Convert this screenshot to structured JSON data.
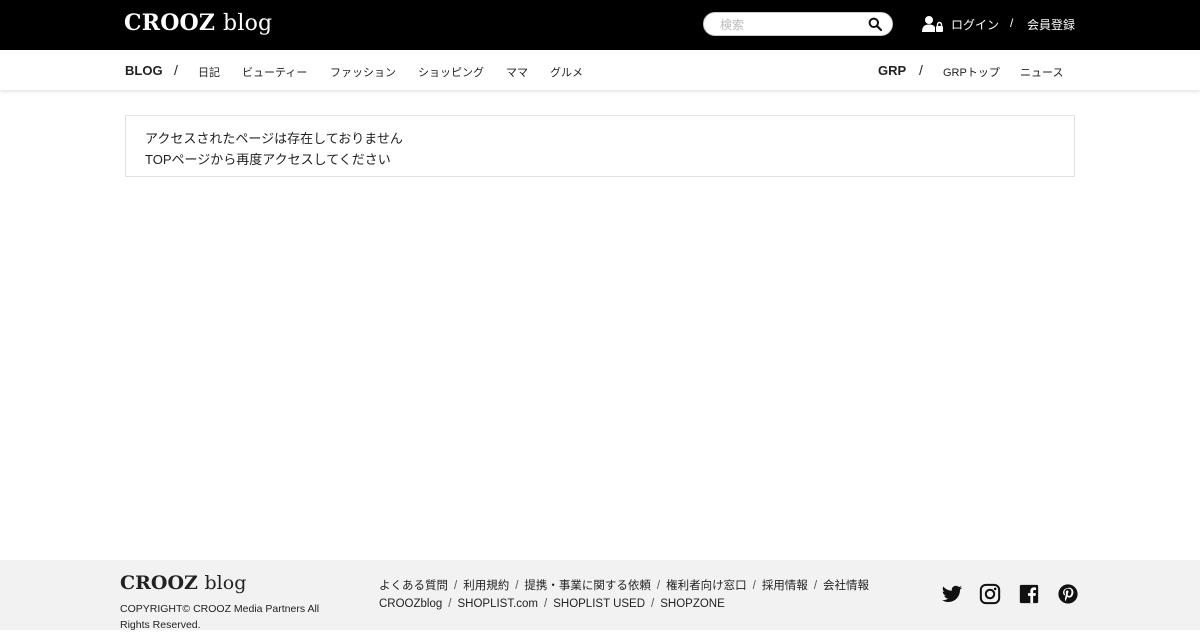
{
  "header": {
    "logo_main": "CROOZ",
    "logo_sub": "blog",
    "search_placeholder": "検索",
    "login_label": "ログイン",
    "separator": "/",
    "register_label": "会員登録"
  },
  "subnav": {
    "blog_label": "BLOG",
    "slash": "/",
    "blog_items": [
      "日記",
      "ビューティー",
      "ファッション",
      "ショッピング",
      "ママ",
      "グルメ"
    ],
    "grp_label": "GRP",
    "grp_items": [
      "GRPトップ",
      "ニュース"
    ]
  },
  "message": {
    "line1": "アクセスされたページは存在しておりません",
    "line2": "TOPページから再度アクセスしてください"
  },
  "footer": {
    "logo_main": "CROOZ",
    "logo_sub": "blog",
    "copyright": "COPYRIGHT© CROOZ Media Partners All Rights Reserved.",
    "links_row1": [
      "よくある質問",
      "利用規約",
      "提携・事業に関する依頼",
      "権利者向け窓口",
      "採用情報",
      "会社情報"
    ],
    "links_row2": [
      "CROOZblog",
      "SHOPLIST.com",
      "SHOPLIST USED",
      "SHOPZONE"
    ],
    "link_separator": "/",
    "social_icons": [
      "twitter-icon",
      "instagram-icon",
      "facebook-icon",
      "pinterest-icon"
    ]
  },
  "colors": {
    "header_bg": "#000000",
    "footer_bg": "#f2f2f2",
    "text": "#222222"
  }
}
